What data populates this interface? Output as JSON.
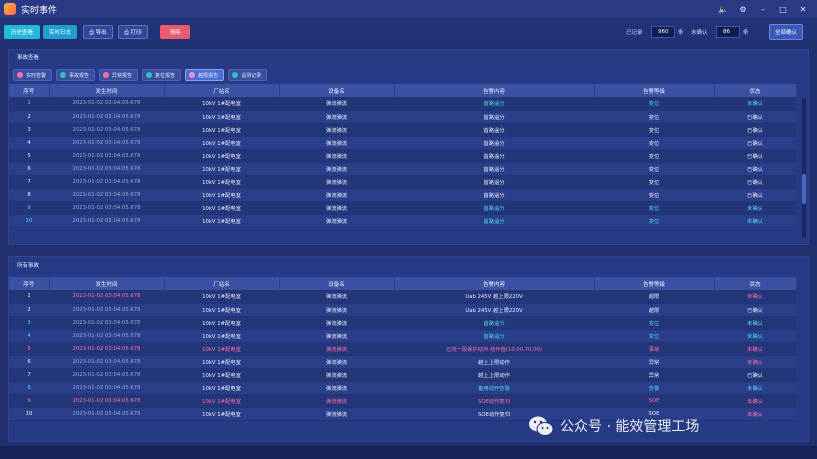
{
  "window": {
    "title": "实时事件",
    "controls": [
      "🔈",
      "⚙",
      "–",
      "□",
      "✕"
    ]
  },
  "toolbar": {
    "history_btn": "历史查看",
    "live_btn": "实时日志",
    "export_btn": "⎙ 导出",
    "print_btn": "⎙ 打印",
    "clear_btn": "清除",
    "recorded_label": "已记录",
    "recorded_value": "960",
    "recorded_unit": "条",
    "unconfirmed_label": "未确认",
    "unconfirmed_value": "86",
    "unconfirmed_unit": "条",
    "confirm_all_btn": "全部确认"
  },
  "top_panel": {
    "title": "事故查看",
    "tabs": [
      {
        "label": "实时告警",
        "color": "#ff6eaa"
      },
      {
        "label": "事故报告",
        "color": "#2fc3c3"
      },
      {
        "label": "异常报告",
        "color": "#ff6eaa"
      },
      {
        "label": "复位报告",
        "color": "#2fc3c3"
      },
      {
        "label": "越限报告",
        "color": "#ff8cc6"
      },
      {
        "label": "遥测记录",
        "color": "#2fc3c3"
      }
    ],
    "columns": [
      "序号",
      "发生时间",
      "厂站名",
      "设备名",
      "告警内容",
      "告警等级",
      "状态"
    ],
    "rows": [
      {
        "no": "1",
        "time": "2023-01-02  03:04:05.678",
        "station": "10kV 1#配电室",
        "device": "弹流弹流",
        "content": "首路遥分",
        "level": "变位",
        "status": "未确认",
        "tone": "cyan"
      },
      {
        "no": "2",
        "time": "2023-01-02  03:04:05.678",
        "station": "10kV 1#配电室",
        "device": "弹流弹流",
        "content": "首路遥分",
        "level": "变位",
        "status": "已确认",
        "tone": "white"
      },
      {
        "no": "3",
        "time": "2023-01-02  03:04:05.678",
        "station": "10kV 1#配电室",
        "device": "弹流弹流",
        "content": "首路遥分",
        "level": "变位",
        "status": "已确认",
        "tone": "white"
      },
      {
        "no": "4",
        "time": "2023-01-02  03:04:05.678",
        "station": "10kV 1#配电室",
        "device": "弹流弹流",
        "content": "首路遥分",
        "level": "变位",
        "status": "已确认",
        "tone": "white"
      },
      {
        "no": "5",
        "time": "2023-01-02  03:04:05.678",
        "station": "10kV 1#配电室",
        "device": "弹流弹流",
        "content": "首路遥分",
        "level": "变位",
        "status": "已确认",
        "tone": "white"
      },
      {
        "no": "6",
        "time": "2023-01-02  03:04:05.678",
        "station": "10kV 1#配电室",
        "device": "弹流弹流",
        "content": "首路遥分",
        "level": "变位",
        "status": "已确认",
        "tone": "white"
      },
      {
        "no": "7",
        "time": "2023-01-02  03:04:05.678",
        "station": "10kV 1#配电室",
        "device": "弹流弹流",
        "content": "首路遥分",
        "level": "变位",
        "status": "已确认",
        "tone": "white"
      },
      {
        "no": "8",
        "time": "2023-01-02  03:04:05.678",
        "station": "10kV 1#配电室",
        "device": "弹流弹流",
        "content": "首路遥分",
        "level": "变位",
        "status": "已确认",
        "tone": "white"
      },
      {
        "no": "9",
        "time": "2023-01-02  03:04:05.678",
        "station": "10kV 1#配电室",
        "device": "弹流弹流",
        "content": "首路遥分",
        "level": "变位",
        "status": "未确认",
        "tone": "cyan"
      },
      {
        "no": "10",
        "time": "2023-01-02  03:04:05.678",
        "station": "10kV 1#配电室",
        "device": "弹流弹流",
        "content": "首路遥分",
        "level": "变位",
        "status": "未确认",
        "tone": "cyan"
      }
    ]
  },
  "bottom_panel": {
    "title": "所有事故",
    "columns": [
      "序号",
      "发生时间",
      "厂站名",
      "设备名",
      "告警内容",
      "告警等级",
      "状态"
    ],
    "rows": [
      {
        "no": "1",
        "time": "2023-01-02  03:04:05.678",
        "station": "10kV 1#配电室",
        "device": "弹流弹流",
        "content": "Uab 245V 越上限220V",
        "level": "越限",
        "status": "未确认",
        "tone": "white",
        "hi": true
      },
      {
        "no": "2",
        "time": "2023-01-02  03:04:05.678",
        "station": "10kV 1#配电室",
        "device": "弹流弹流",
        "content": "Uab 245V 越上限220V",
        "level": "越限",
        "status": "已确认",
        "tone": "white",
        "hi": false
      },
      {
        "no": "3",
        "time": "2023-01-02  03:04:05.678",
        "station": "10kV 1#配电室",
        "device": "弹流弹流",
        "content": "首路遥分",
        "level": "变位",
        "status": "未确认",
        "tone": "cyan",
        "hi": false
      },
      {
        "no": "4",
        "time": "2023-01-02  03:04:05.678",
        "station": "10kV 1#配电室",
        "device": "弹流弹流",
        "content": "首路遥分",
        "level": "变位",
        "status": "未确认",
        "tone": "cyan",
        "hi": false
      },
      {
        "no": "5",
        "time": "2023-01-02  03:04:05.678",
        "station": "10kV 1#配电室",
        "device": "弹流弹流",
        "content": "过流一段保护动作 动作值(10,00,70,00)",
        "level": "事故",
        "status": "未确认",
        "tone": "pink",
        "hi": true
      },
      {
        "no": "6",
        "time": "2023-01-02  03:04:05.678",
        "station": "10kV 1#配电室",
        "device": "弹流弹流",
        "content": "越上上限动作",
        "level": "异常",
        "status": "未确认",
        "tone": "white",
        "hi": false
      },
      {
        "no": "7",
        "time": "2023-01-02  03:04:05.678",
        "station": "10kV 1#配电室",
        "device": "弹流弹流",
        "content": "越上上限动作",
        "level": "异常",
        "status": "已确认",
        "tone": "white",
        "hi": false
      },
      {
        "no": "8",
        "time": "2023-01-02  03:04:05.678",
        "station": "10kV 1#配电室",
        "device": "弹流弹流",
        "content": "备用动作告警",
        "level": "告警",
        "status": "未确认",
        "tone": "cyan",
        "hi": false
      },
      {
        "no": "9",
        "time": "2023-01-02  03:04:05.678",
        "station": "10kV 1#配电室",
        "device": "弹流弹流",
        "content": "SOE动作复归",
        "level": "SOE",
        "status": "未确认",
        "tone": "pink",
        "hi": true
      },
      {
        "no": "10",
        "time": "2023-01-02  03:04:05.678",
        "station": "10kV 1#配电室",
        "device": "弹流弹流",
        "content": "SOE动作复归",
        "level": "SOE",
        "status": "未确认",
        "tone": "white",
        "hi": false
      }
    ]
  },
  "watermark": "公众号 · 能效管理工场",
  "colors": {
    "background": "#20306f",
    "accent_cyan": "#4fd8e6",
    "accent_pink": "#ff6eaa"
  }
}
